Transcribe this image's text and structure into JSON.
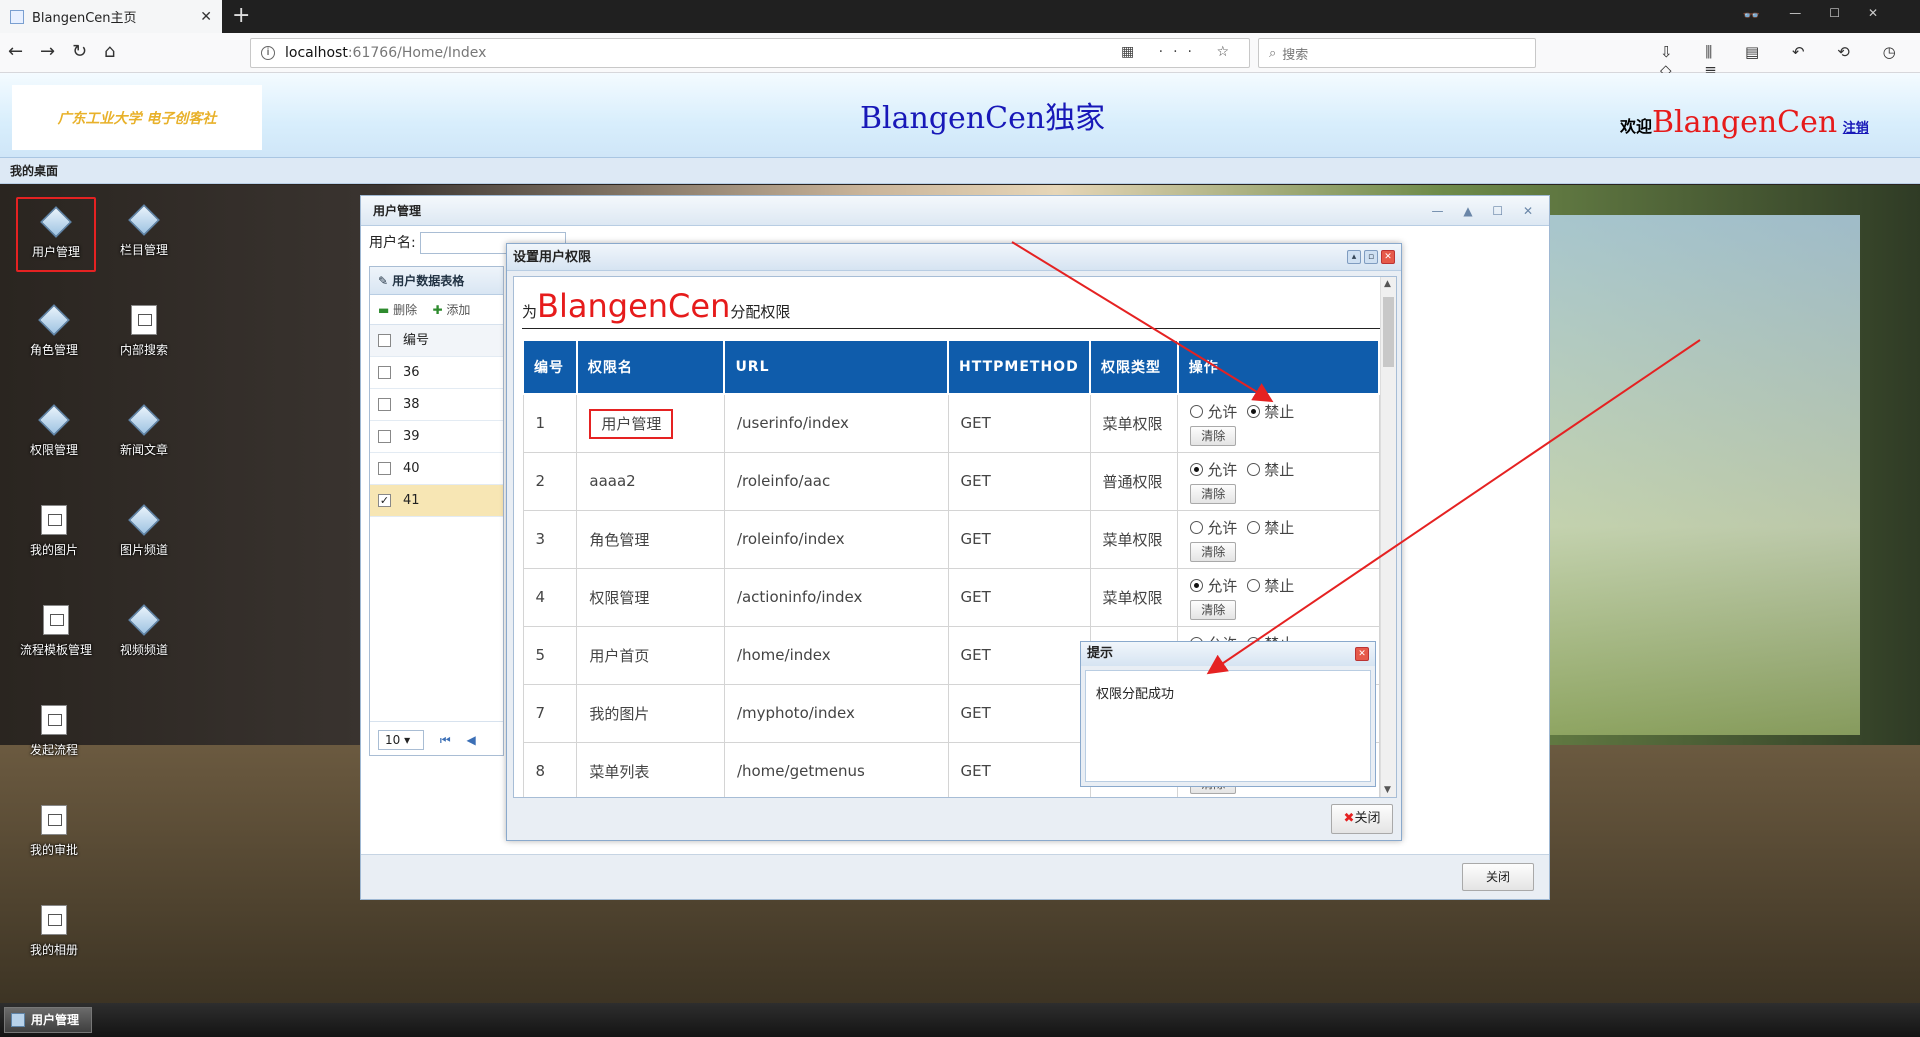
{
  "browser": {
    "tab_title": "BlangenCen主页",
    "url_host": "localhost",
    "url_path": ":61766/Home/Index",
    "search_placeholder": "搜索"
  },
  "header": {
    "logo_text": "广东工业大学 电子创客社",
    "brand": "BlangenCen独家",
    "welcome_prefix": "欢迎",
    "user_name": "BlangenCen",
    "logout": "注销"
  },
  "desk_bar": "我的桌面",
  "desktop_icons": [
    {
      "label": "用户管理",
      "icon": "cube-icon"
    },
    {
      "label": "栏目管理",
      "icon": "cube-icon"
    },
    {
      "label": "角色管理",
      "icon": "cube-icon"
    },
    {
      "label": "内部搜索",
      "icon": "doc-icon"
    },
    {
      "label": "权限管理",
      "icon": "cube-icon"
    },
    {
      "label": "新闻文章",
      "icon": "cube-icon"
    },
    {
      "label": "我的图片",
      "icon": "doc-icon"
    },
    {
      "label": "图片频道",
      "icon": "cube-icon"
    },
    {
      "label": "流程模板管理",
      "icon": "doc-icon"
    },
    {
      "label": "视频频道",
      "icon": "cube-icon"
    },
    {
      "label": "发起流程",
      "icon": "doc-icon"
    },
    {
      "label": "我的审批",
      "icon": "doc-icon"
    },
    {
      "label": "我的相册",
      "icon": "doc-icon"
    }
  ],
  "taskbar": {
    "button": "用户管理"
  },
  "user_window": {
    "title": "用户管理",
    "search_label": "用户名:",
    "grid_title": "用户数据表格",
    "delete_label": "删除",
    "add_label": "添加",
    "col_id": "编号",
    "rows": [
      "36",
      "38",
      "39",
      "40",
      "41"
    ],
    "page_size": "10",
    "close": "关闭"
  },
  "perm_dialog": {
    "title": "设置用户权限",
    "heading_prefix": "为",
    "heading_name": "BlangenCen",
    "heading_suffix": "分配权限",
    "columns": [
      "编号",
      "权限名",
      "URL",
      "HTTPMETHOD",
      "权限类型",
      "操作"
    ],
    "rows": [
      {
        "id": "1",
        "name": "用户管理",
        "url": "/userinfo/index",
        "method": "GET",
        "type": "菜单权限",
        "allow": false,
        "deny": true
      },
      {
        "id": "2",
        "name": "aaaa2",
        "url": "/roleinfo/aac",
        "method": "GET",
        "type": "普通权限",
        "allow": true,
        "deny": false
      },
      {
        "id": "3",
        "name": "角色管理",
        "url": "/roleinfo/index",
        "method": "GET",
        "type": "菜单权限",
        "allow": false,
        "deny": false
      },
      {
        "id": "4",
        "name": "权限管理",
        "url": "/actioninfo/index",
        "method": "GET",
        "type": "菜单权限",
        "allow": true,
        "deny": false
      },
      {
        "id": "5",
        "name": "用户首页",
        "url": "/home/index",
        "method": "GET",
        "type": "",
        "allow": false,
        "deny": false
      },
      {
        "id": "7",
        "name": "我的图片",
        "url": "/myphoto/index",
        "method": "GET",
        "type": "",
        "allow": false,
        "deny": false
      },
      {
        "id": "8",
        "name": "菜单列表",
        "url": "/home/getmenus",
        "method": "GET",
        "type": "",
        "allow": false,
        "deny": false
      }
    ],
    "allow_label": "允许",
    "deny_label": "禁止",
    "clear_label": "清除",
    "close": "关闭"
  },
  "tip": {
    "title": "提示",
    "message": "权限分配成功"
  },
  "colors": {
    "table_header": "#0f5cab",
    "accent_red": "#e61b1b",
    "brand_blue": "#1818b8"
  }
}
